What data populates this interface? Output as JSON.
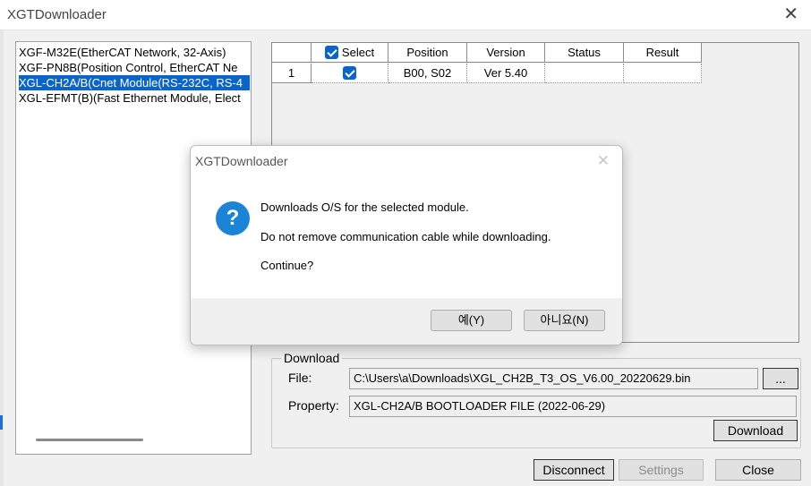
{
  "window": {
    "title": "XGTDownloader",
    "close_glyph": "✕"
  },
  "modules": [
    {
      "label": "XGF-M32E(EtherCAT Network, 32-Axis)",
      "selected": false
    },
    {
      "label": "XGF-PN8B(Position Control, EtherCAT Ne",
      "selected": false
    },
    {
      "label": "XGL-CH2A/B(Cnet Module(RS-232C, RS-4",
      "selected": true
    },
    {
      "label": "XGL-EFMT(B)(Fast Ethernet Module, Elect",
      "selected": false
    }
  ],
  "grid": {
    "headers": {
      "select": "Select",
      "position": "Position",
      "version": "Version",
      "status": "Status",
      "result": "Result"
    },
    "rows": [
      {
        "num": "1",
        "position": "B00, S02",
        "version": "Ver 5.40",
        "status": "",
        "result": ""
      }
    ]
  },
  "download": {
    "group_label": "Download",
    "file_label": "File:",
    "file_value": "C:\\Users\\a\\Downloads\\XGL_CH2B_T3_OS_V6.00_20220629.bin",
    "browse_label": "...",
    "property_label": "Property:",
    "property_value": "XGL-CH2A/B BOOTLOADER FILE (2022-06-29)",
    "download_button": "Download"
  },
  "bottom_buttons": {
    "disconnect": "Disconnect",
    "settings": "Settings",
    "close": "Close"
  },
  "dialog": {
    "title": "XGTDownloader",
    "close_glyph": "✕",
    "icon_glyph": "?",
    "line1": "Downloads O/S for the selected module.",
    "line2": "Do not remove communication cable while downloading.",
    "line3": "Continue?",
    "yes": "예(Y)",
    "no": "아니요(N)"
  },
  "colors": {
    "selection": "#0b64c8",
    "question_icon": "#1c84d6"
  }
}
